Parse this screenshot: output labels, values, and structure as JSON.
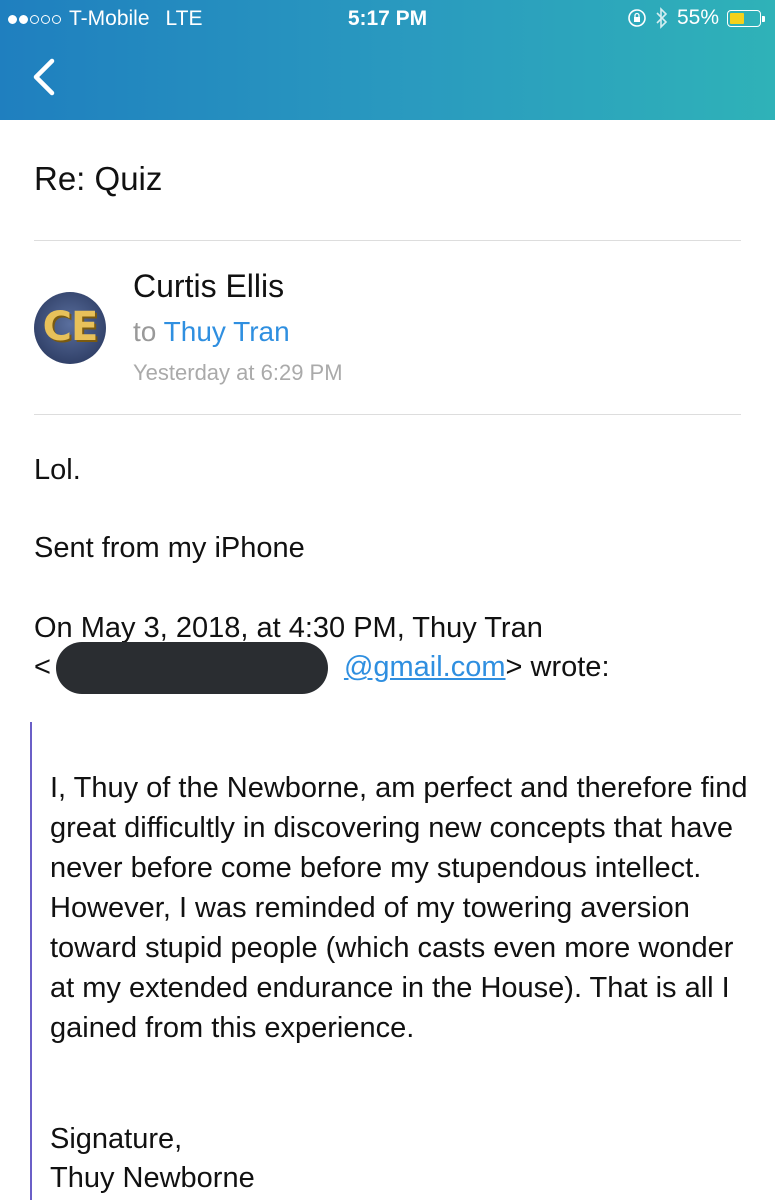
{
  "status_bar": {
    "carrier": "T-Mobile",
    "network": "LTE",
    "time": "5:17 PM",
    "battery": "55%",
    "battery_level": 0.55,
    "battery_color": "#f5d11c"
  },
  "nav": {
    "back_icon": "chevron-left-icon"
  },
  "email": {
    "subject": "Re: Quiz",
    "sender": "Curtis Ellis",
    "avatar_initials": "CE",
    "to_prefix": "to",
    "recipient": "Thuy Tran",
    "date": "Yesterday at 6:29 PM",
    "body_line1": "Lol.",
    "body_line2": "Sent from my iPhone",
    "reply_header": "On May 3, 2018, at 4:30 PM, Thuy Tran",
    "reply_email_open": "<",
    "reply_email_visible": "@gmail.com",
    "reply_email_close": "> wrote:",
    "quoted": {
      "paragraph": "I, Thuy of the Newborne, am perfect and therefore find great difficultly in discovering new concepts that have never before come before my stupendous intellect. However, I was reminded of my towering aversion toward stupid people (which casts even more wonder at my extended endurance in the House). That is all I gained from this experience.",
      "signature_line1": "Signature,",
      "signature_line2": "Thuy Newborne"
    }
  },
  "colors": {
    "accent": "#2f8fe0",
    "quote_bar": "#6b5fc7",
    "header_gradient_start": "#1f7fbf",
    "header_gradient_end": "#2fb2b8"
  }
}
